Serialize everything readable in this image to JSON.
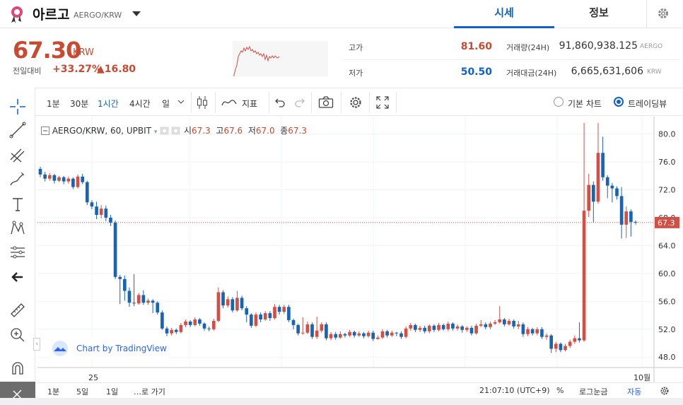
{
  "header": {
    "coin_name": "아르고",
    "pair": "AERGO/KRW",
    "tabs": [
      {
        "label": "시세"
      },
      {
        "label": "정보"
      }
    ]
  },
  "summary": {
    "price": "67.30",
    "price_unit": "KRW",
    "prev_label": "전일대비",
    "change_rate": "+33.27%",
    "change_amount": "▲16.80",
    "high_label": "고가",
    "high_value": "81.60",
    "low_label": "저가",
    "low_value": "50.50",
    "volume_label": "거래량(24H)",
    "volume_value": "91,860,938.125",
    "volume_unit": "AERGO",
    "amount_label": "거래대금(24H)",
    "amount_value": "6,665,631,606",
    "amount_unit": "KRW"
  },
  "toolbar": {
    "intervals": [
      "1분",
      "30분",
      "1시간",
      "4시간",
      "일"
    ],
    "active_interval": "1시간",
    "indicator_label": "지표",
    "basic_chart_label": "기본 차트",
    "tradingview_label": "트레이딩뷰"
  },
  "legend": {
    "title": "AERGO/KRW, 60, UPBIT",
    "open_label": "시",
    "open": "67.3",
    "high_label": "고",
    "high": "67.6",
    "low_label": "저",
    "low": "67.0",
    "close_label": "종",
    "close": "67.3"
  },
  "watermark": "Chart by TradingView",
  "bottom_bar": {
    "ranges": [
      "1분",
      "5일",
      "1일",
      "…로 가기"
    ],
    "time": "21:07:10 (UTC+9)",
    "percent": "%",
    "log": "로그눈금",
    "auto": "자동"
  },
  "colors": {
    "up": "#d24f45",
    "down": "#1763b6",
    "accent": "#1261c4",
    "last_price_tag": "#d24f45"
  },
  "chart_data": {
    "type": "candlestick",
    "x_tick_labels": [
      "25",
      "10월"
    ],
    "y_ticks": [
      48.0,
      52.0,
      56.0,
      60.0,
      64.0,
      68.0,
      72.0,
      76.0,
      80.0
    ],
    "ylim": [
      46.5,
      82.5
    ],
    "last_price": "67.3",
    "grid": true,
    "candles": [
      [
        75.0,
        74.2,
        75.3,
        73.8
      ],
      [
        74.2,
        73.6,
        74.6,
        73.2
      ],
      [
        73.6,
        74.1,
        74.4,
        73.3
      ],
      [
        74.1,
        73.3,
        74.3,
        72.9
      ],
      [
        73.3,
        73.8,
        74.0,
        73.1
      ],
      [
        73.8,
        73.2,
        74.0,
        72.8
      ],
      [
        73.2,
        73.6,
        73.9,
        72.9
      ],
      [
        73.6,
        72.4,
        73.8,
        72.1
      ],
      [
        72.4,
        73.9,
        74.2,
        72.2
      ],
      [
        73.9,
        73.1,
        74.3,
        72.8
      ],
      [
        73.1,
        70.2,
        73.3,
        69.8
      ],
      [
        70.2,
        69.6,
        70.5,
        69.2
      ],
      [
        69.6,
        68.4,
        70.3,
        67.8
      ],
      [
        68.4,
        69.3,
        69.8,
        67.9
      ],
      [
        69.3,
        68.0,
        69.7,
        67.5
      ],
      [
        68.0,
        67.3,
        68.4,
        66.8
      ],
      [
        67.3,
        59.5,
        67.6,
        59.2
      ],
      [
        59.5,
        59.2,
        59.8,
        55.6
      ],
      [
        59.2,
        57.5,
        59.7,
        56.1
      ],
      [
        57.5,
        55.8,
        58.0,
        55.2
      ],
      [
        55.8,
        55.7,
        59.9,
        55.3
      ],
      [
        55.7,
        56.9,
        57.2,
        55.5
      ],
      [
        56.9,
        55.8,
        57.6,
        55.5
      ],
      [
        55.8,
        56.1,
        56.4,
        55.5
      ],
      [
        56.1,
        55.8,
        56.3,
        54.3
      ],
      [
        55.8,
        54.4,
        56.0,
        54.1
      ],
      [
        54.4,
        52.1,
        54.7,
        51.9
      ],
      [
        52.1,
        51.4,
        52.4,
        51.0
      ],
      [
        51.4,
        51.9,
        52.2,
        51.1
      ],
      [
        51.9,
        51.6,
        52.1,
        51.3
      ],
      [
        51.6,
        52.6,
        52.9,
        51.4
      ],
      [
        52.6,
        53.1,
        53.4,
        52.3
      ],
      [
        53.1,
        52.6,
        53.3,
        52.3
      ],
      [
        52.6,
        53.4,
        53.7,
        52.4
      ],
      [
        53.4,
        52.8,
        53.6,
        52.5
      ],
      [
        52.8,
        52.1,
        53.0,
        51.8
      ],
      [
        52.1,
        52.0,
        52.4,
        51.7
      ],
      [
        52.0,
        53.2,
        53.5,
        51.8
      ],
      [
        53.2,
        57.3,
        58.0,
        53.0
      ],
      [
        57.3,
        55.4,
        57.6,
        55.0
      ],
      [
        55.4,
        56.3,
        56.7,
        55.1
      ],
      [
        56.3,
        54.7,
        56.6,
        54.4
      ],
      [
        54.7,
        56.5,
        57.5,
        54.5
      ],
      [
        56.5,
        55.0,
        56.8,
        54.7
      ],
      [
        55.0,
        54.1,
        55.3,
        53.0
      ],
      [
        54.1,
        52.5,
        54.3,
        52.2
      ],
      [
        52.5,
        54.1,
        54.4,
        52.3
      ],
      [
        54.1,
        53.4,
        54.4,
        53.0
      ],
      [
        53.4,
        54.3,
        54.6,
        53.2
      ],
      [
        54.3,
        53.6,
        54.6,
        53.2
      ],
      [
        53.6,
        55.2,
        55.6,
        53.4
      ],
      [
        55.2,
        54.5,
        55.5,
        54.1
      ],
      [
        54.5,
        55.2,
        55.5,
        54.2
      ],
      [
        55.2,
        53.3,
        55.5,
        53.0
      ],
      [
        53.3,
        52.6,
        53.5,
        52.0
      ],
      [
        52.6,
        51.4,
        52.8,
        51.1
      ],
      [
        51.4,
        51.5,
        53.7,
        51.2
      ],
      [
        51.5,
        52.7,
        53.1,
        51.3
      ],
      [
        52.7,
        50.9,
        53.0,
        50.6
      ],
      [
        50.9,
        51.8,
        53.8,
        50.6
      ],
      [
        51.8,
        52.7,
        53.0,
        51.5
      ],
      [
        52.7,
        50.7,
        53.0,
        50.4
      ],
      [
        50.7,
        51.3,
        51.6,
        50.4
      ],
      [
        51.3,
        50.8,
        51.6,
        50.5
      ],
      [
        50.8,
        51.3,
        51.7,
        50.6
      ],
      [
        51.3,
        51.1,
        51.5,
        50.8
      ],
      [
        51.1,
        51.6,
        51.9,
        50.9
      ],
      [
        51.6,
        51.1,
        51.8,
        50.8
      ],
      [
        51.1,
        51.4,
        51.7,
        50.9
      ],
      [
        51.4,
        51.0,
        51.6,
        50.7
      ],
      [
        51.0,
        51.5,
        51.8,
        50.8
      ],
      [
        51.5,
        50.6,
        51.8,
        50.3
      ],
      [
        50.6,
        50.8,
        51.1,
        50.5
      ],
      [
        50.8,
        51.7,
        52.0,
        50.6
      ],
      [
        51.7,
        51.1,
        51.9,
        50.8
      ],
      [
        51.1,
        51.5,
        51.8,
        50.9
      ],
      [
        51.5,
        51.4,
        51.6,
        51.0
      ],
      [
        51.4,
        50.9,
        51.7,
        50.6
      ],
      [
        50.9,
        52.1,
        52.4,
        50.7
      ],
      [
        52.1,
        52.6,
        52.9,
        51.8
      ],
      [
        52.6,
        51.9,
        52.8,
        51.6
      ],
      [
        51.9,
        52.2,
        52.5,
        51.6
      ],
      [
        52.2,
        51.7,
        52.5,
        51.4
      ],
      [
        51.7,
        52.5,
        52.7,
        51.4
      ],
      [
        52.5,
        51.9,
        52.7,
        51.6
      ],
      [
        51.9,
        52.6,
        52.9,
        51.7
      ],
      [
        52.6,
        52.0,
        52.8,
        51.8
      ],
      [
        52.0,
        52.8,
        53.1,
        51.7
      ],
      [
        52.8,
        52.1,
        53.0,
        51.8
      ],
      [
        52.1,
        52.4,
        52.7,
        51.8
      ],
      [
        52.4,
        51.9,
        52.6,
        51.5
      ],
      [
        51.9,
        52.2,
        52.4,
        51.6
      ],
      [
        52.2,
        51.4,
        52.5,
        51.1
      ],
      [
        51.4,
        52.5,
        52.8,
        51.2
      ],
      [
        52.5,
        52.7,
        53.3,
        52.3
      ],
      [
        52.7,
        52.3,
        53.0,
        52.0
      ],
      [
        52.3,
        52.8,
        53.1,
        52.0
      ],
      [
        52.8,
        53.0,
        53.3,
        52.6
      ],
      [
        53.0,
        53.4,
        55.3,
        52.8
      ],
      [
        53.4,
        52.7,
        53.6,
        52.4
      ],
      [
        52.7,
        53.2,
        53.5,
        52.5
      ],
      [
        53.2,
        52.4,
        53.4,
        52.1
      ],
      [
        52.4,
        52.7,
        53.2,
        52.0
      ],
      [
        52.7,
        51.3,
        53.0,
        50.9
      ],
      [
        51.3,
        52.0,
        52.3,
        51.0
      ],
      [
        52.0,
        51.4,
        52.2,
        51.1
      ],
      [
        51.4,
        52.0,
        52.3,
        51.1
      ],
      [
        52.0,
        50.9,
        52.3,
        50.6
      ],
      [
        50.9,
        51.1,
        51.4,
        50.5
      ],
      [
        51.1,
        49.2,
        51.3,
        48.6
      ],
      [
        49.2,
        49.9,
        50.2,
        48.7
      ],
      [
        49.9,
        49.0,
        50.1,
        48.7
      ],
      [
        49.0,
        49.6,
        49.9,
        48.8
      ],
      [
        49.6,
        50.2,
        50.5,
        49.3
      ],
      [
        50.2,
        50.7,
        51.1,
        49.9
      ],
      [
        50.7,
        50.4,
        53.0,
        50.1
      ],
      [
        50.4,
        69.0,
        81.6,
        50.2
      ],
      [
        69.0,
        72.7,
        74.3,
        68.1
      ],
      [
        72.7,
        70.3,
        73.2,
        67.3
      ],
      [
        70.3,
        77.3,
        81.6,
        70.0
      ],
      [
        77.3,
        73.8,
        79.6,
        73.3
      ],
      [
        73.8,
        72.6,
        74.1,
        70.8
      ],
      [
        72.6,
        72.2,
        73.0,
        70.2
      ],
      [
        72.2,
        71.1,
        72.5,
        70.6
      ],
      [
        71.1,
        67.0,
        72.4,
        65.0
      ],
      [
        67.0,
        68.9,
        69.6,
        65.1
      ],
      [
        68.9,
        67.4,
        69.2,
        65.3
      ],
      [
        67.4,
        67.3,
        67.6,
        67.0
      ]
    ]
  }
}
